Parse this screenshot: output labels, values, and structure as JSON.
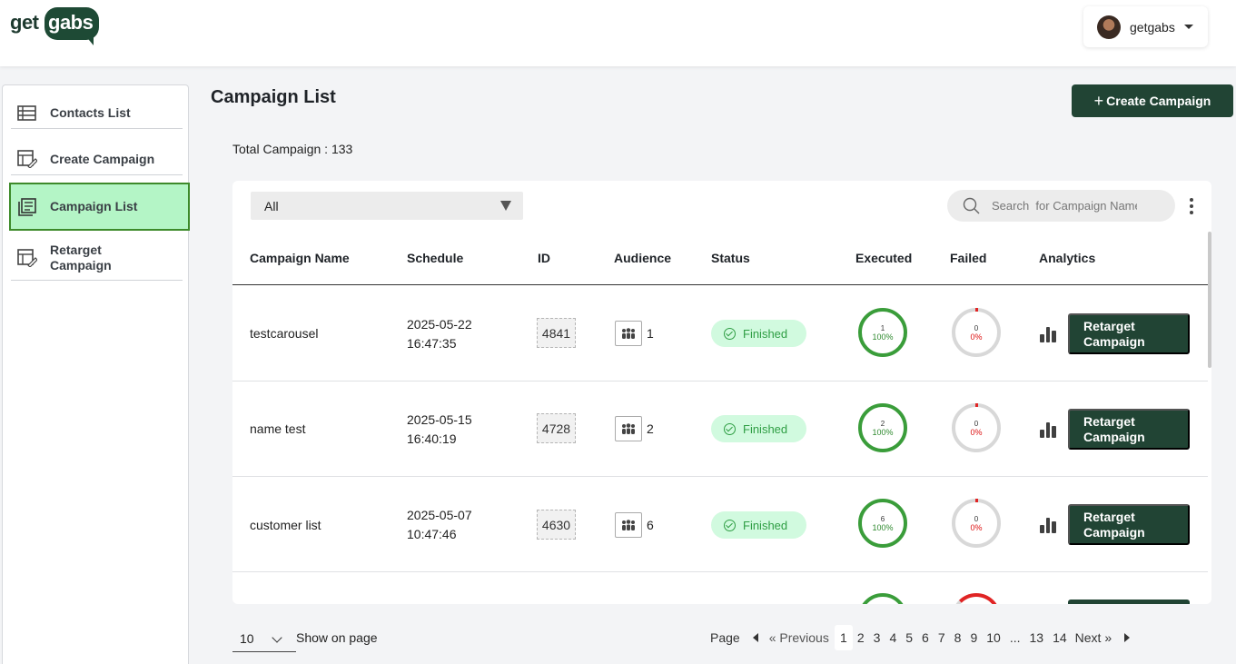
{
  "header": {
    "logo_get": "get",
    "logo_gabs": "gabs",
    "user_name": "getgabs"
  },
  "sidebar": {
    "items": [
      {
        "label": "Contacts List",
        "icon": "table-icon"
      },
      {
        "label": "Create Campaign",
        "icon": "edit-table-icon"
      },
      {
        "label": "Campaign List",
        "icon": "list-doc-icon",
        "active": true
      },
      {
        "label": "Retarget Campaign",
        "icon": "edit-table-icon"
      }
    ]
  },
  "main": {
    "title": "Campaign List",
    "create_button": "Create Campaign",
    "total_label": "Total Campaign : 133",
    "filter_value": "All",
    "search_placeholder": "Search  for Campaign Name",
    "columns": [
      "Campaign Name",
      "Schedule",
      "ID",
      "Audience",
      "Status",
      "Executed",
      "Failed",
      "Analytics"
    ],
    "rows": [
      {
        "name": "testcarousel",
        "date": "2025-05-22",
        "time": "16:47:35",
        "id": "4841",
        "audience": "1",
        "status": "Finished",
        "executed_count": "1",
        "executed_pct": "100%",
        "failed_count": "0",
        "failed_pct": "0%",
        "action": "Retarget Campaign"
      },
      {
        "name": "name test",
        "date": "2025-05-15",
        "time": "16:40:19",
        "id": "4728",
        "audience": "2",
        "status": "Finished",
        "executed_count": "2",
        "executed_pct": "100%",
        "failed_count": "0",
        "failed_pct": "0%",
        "action": "Retarget Campaign"
      },
      {
        "name": "customer list",
        "date": "2025-05-07",
        "time": "10:47:46",
        "id": "4630",
        "audience": "6",
        "status": "Finished",
        "executed_count": "6",
        "executed_pct": "100%",
        "failed_count": "0",
        "failed_pct": "0%",
        "action": "Retarget Campaign"
      }
    ]
  },
  "footer": {
    "per_page": "10",
    "show_label": "Show on page",
    "page_label": "Page",
    "previous": "« Previous",
    "pages": [
      "1",
      "2",
      "3",
      "4",
      "5",
      "6",
      "7",
      "8",
      "9",
      "10",
      "...",
      "13",
      "14"
    ],
    "current_page": "1",
    "next": "Next »"
  },
  "colors": {
    "brand": "#214434",
    "active_bg": "#b4f5c6",
    "success": "#2f9e44",
    "danger": "#e02424"
  }
}
